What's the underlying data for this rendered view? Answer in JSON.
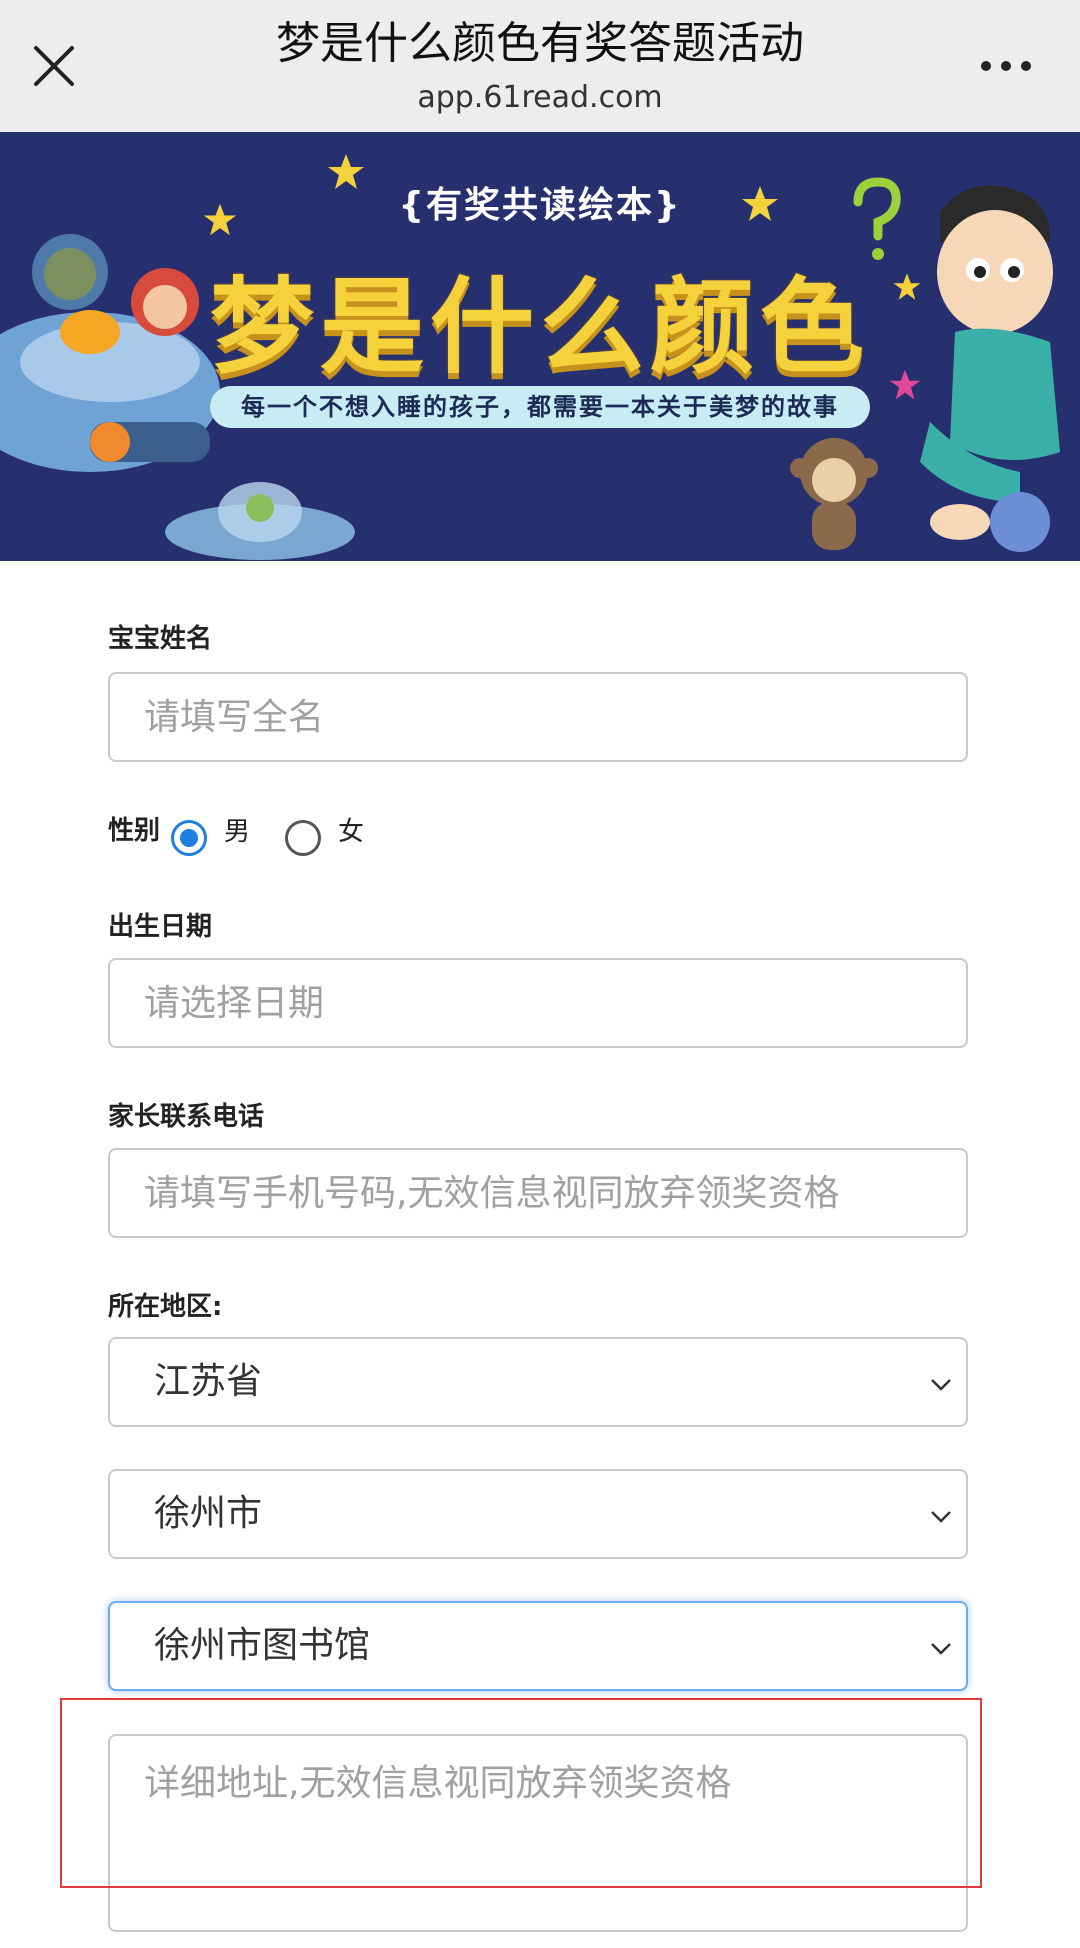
{
  "header": {
    "title": "梦是什么颜色有奖答题活动",
    "url": "app.61read.com"
  },
  "banner": {
    "tag": "{有奖共读绘本}",
    "title": "梦是什么颜色",
    "slogan": "每一个不想入睡的孩子，都需要一本关于美梦的故事"
  },
  "form": {
    "name_label": "宝宝姓名",
    "name_placeholder": "请填写全名",
    "gender_label": "性别",
    "gender_male": "男",
    "gender_female": "女",
    "gender_selected": "男",
    "birth_label": "出生日期",
    "birth_placeholder": "请选择日期",
    "phone_label": "家长联系电话",
    "phone_placeholder": "请填写手机号码,无效信息视同放弃领奖资格",
    "region_label": "所在地区:",
    "province_value": "江苏省",
    "city_value": "徐州市",
    "library_value": "徐州市图书馆",
    "address_placeholder": "详细地址,无效信息视同放弃领奖资格"
  },
  "colors": {
    "banner_bg": "#27306e",
    "banner_title": "#f5d23b",
    "radio_selected": "#1e7fe0",
    "highlight": "#e23a3a"
  }
}
